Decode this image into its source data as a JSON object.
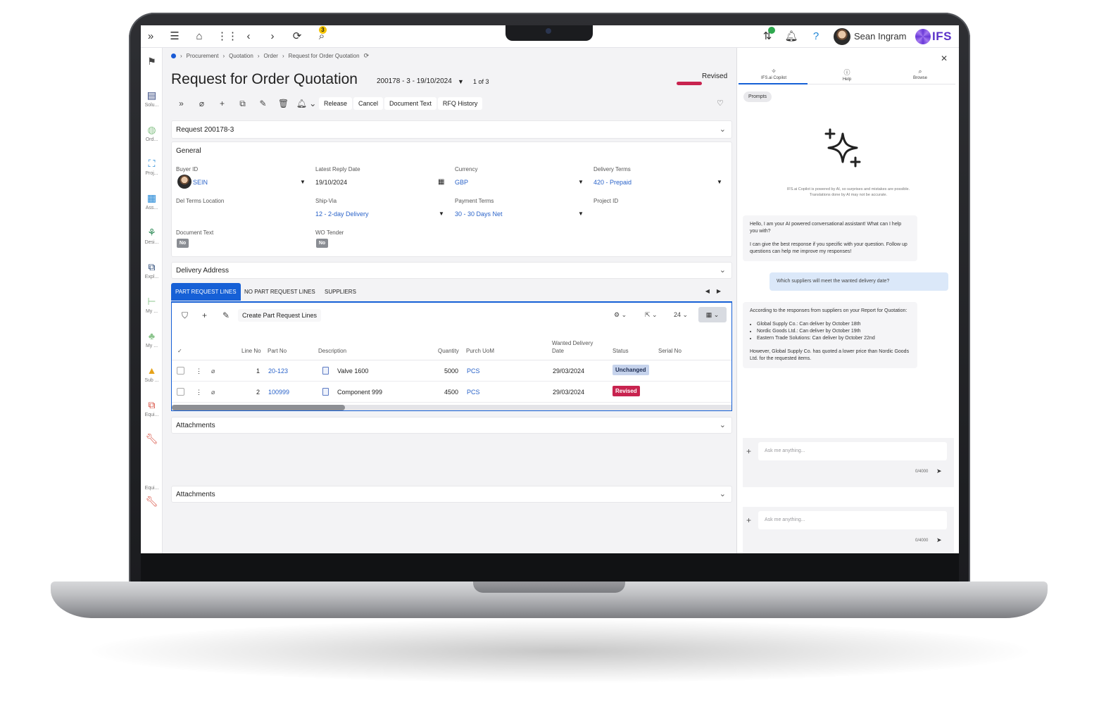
{
  "topbar": {
    "notification_count": "3",
    "user_name": "Sean Ingram",
    "logo_text": "IFS"
  },
  "rail": {
    "items": [
      {
        "label": "Solu...",
        "icon": "hierarchy-icon"
      },
      {
        "label": "Ord...",
        "icon": "order-icon"
      },
      {
        "label": "Proj...",
        "icon": "project-icon"
      },
      {
        "label": "Ass...",
        "icon": "asset-grid-icon"
      },
      {
        "label": "Desi...",
        "icon": "design-icon"
      },
      {
        "label": "Expl...",
        "icon": "explorer-icon"
      },
      {
        "label": "My ...",
        "icon": "my-work-icon"
      },
      {
        "label": "My ...",
        "icon": "my-team-icon"
      },
      {
        "label": "Sub ...",
        "icon": "cone-icon"
      },
      {
        "label": "Equi...",
        "icon": "equipment-icon"
      },
      {
        "label": "Equi...",
        "icon": "wrench-icon"
      }
    ]
  },
  "breadcrumb": [
    "Procurement",
    "Quotation",
    "Order",
    "Request for Order Quotation"
  ],
  "header": {
    "title": "Request for Order Quotation",
    "record_selector": "200178 - 3 - 19/10/2024",
    "record_count": "1 of 3",
    "status": "Revised"
  },
  "commands": [
    "Release",
    "Cancel",
    "Document Text",
    "RFQ History"
  ],
  "request_card": {
    "title": "Request 200178-3"
  },
  "general": {
    "title": "General",
    "buyer_id_label": "Buyer ID",
    "buyer_id": "SEIN",
    "latest_reply_date_label": "Latest Reply Date",
    "latest_reply_date": "19/10/2024",
    "currency_label": "Currency",
    "currency": "GBP",
    "delivery_terms_label": "Delivery Terms",
    "delivery_terms": "420 - Prepaid",
    "del_terms_location_label": "Del Terms Location",
    "ship_via_label": "Ship-Via",
    "ship_via": "12 - 2-day Delivery",
    "payment_terms_label": "Payment Terms",
    "payment_terms": "30 - 30 Days Net",
    "project_id_label": "Project ID",
    "document_text_label": "Document Text",
    "document_text": "No",
    "wo_tender_label": "WO Tender",
    "wo_tender": "No"
  },
  "delivery_address": {
    "title": "Delivery Address"
  },
  "tabs": [
    "PART REQUEST LINES",
    "NO PART REQUEST LINES",
    "SUPPLIERS"
  ],
  "grid": {
    "create_button": "Create Part Request Lines",
    "page_size": "24",
    "columns": {
      "line_no": "Line No",
      "part_no": "Part No",
      "description": "Description",
      "quantity": "Quantity",
      "purch_uom": "Purch UoM",
      "wanted_delivery_date_1": "Wanted Delivery",
      "wanted_delivery_date_2": "Date",
      "status": "Status",
      "serial_no": "Serial No"
    },
    "rows": [
      {
        "line_no": "1",
        "part_no": "20-123",
        "description": "Valve 1600",
        "quantity": "5000",
        "uom": "PCS",
        "date": "29/03/2024",
        "status": "Unchanged"
      },
      {
        "line_no": "2",
        "part_no": "100999",
        "description": "Component 999",
        "quantity": "4500",
        "uom": "PCS",
        "date": "29/03/2024",
        "status": "Revised"
      }
    ],
    "scroll_fraction": 0.31
  },
  "attachments": [
    {
      "title": "Attachments"
    },
    {
      "title": "Attachments"
    }
  ],
  "panel": {
    "tabs": [
      {
        "label": "IFS.ai Copilot",
        "icon": "copilot-icon"
      },
      {
        "label": "Help",
        "icon": "help-icon"
      },
      {
        "label": "Browse",
        "icon": "search-icon"
      }
    ],
    "prompts_chip": "Prompts",
    "disclaimer_1": "IFS.ai Copilot is powered by AI, so surprises and mistakes are possible.",
    "disclaimer_2": "Translations done by AI may not be accurate.",
    "greeting_1": "Hello, I am your AI powered conversational assistant! What can I help you with?",
    "greeting_2": "I can give the best response if you specific with your question. Follow up questions can help me improve my responses!",
    "user_question": "Which suppliers will meet the wanted delivery date?",
    "answer_intro": "According to the responses from suppliers on your Report for Quotation:",
    "answer_items": [
      "Global Supply Co.: Can deliver by October 18th",
      "Nordic Goods Ltd.: Can deliver by October 19th",
      "Eastern Trade Solutions: Can deliver by October 22nd"
    ],
    "answer_outro": "However, Global Supply Co. has quoted a lower price than Nordic Goods Ltd. for the requested items.",
    "ask_placeholder": "Ask me anything...",
    "char_count": "0/4000"
  },
  "colors": {
    "accent": "#1660d6",
    "revised": "#c8234f",
    "unchanged_bg": "#c6d3ec",
    "link": "#2a63c9"
  }
}
